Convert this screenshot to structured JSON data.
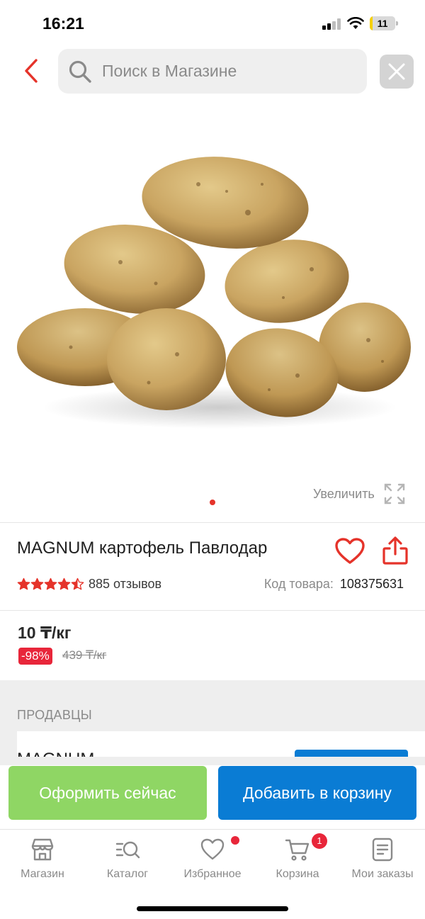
{
  "status_bar": {
    "time": "16:21",
    "battery": "11",
    "battery_level": 0.11
  },
  "search": {
    "placeholder": "Поиск в Магазине"
  },
  "product": {
    "zoom_label": "Увеличить",
    "title": "MAGNUM картофель Павлодар",
    "rating": 4.5,
    "reviews": "885 отзывов",
    "sku_label": "Код товара:",
    "sku_value": "108375631",
    "price": "10 ₸/кг",
    "discount": "-98%",
    "old_price": "439 ₸/кг"
  },
  "sellers": {
    "title": "ПРОДАВЦЫ",
    "first_seller": "MAGNUM"
  },
  "actions": {
    "checkout": "Оформить сейчас",
    "add_to_cart": "Добавить в корзину"
  },
  "tabbar": {
    "items": [
      {
        "label": "Магазин",
        "icon": "store-icon"
      },
      {
        "label": "Каталог",
        "icon": "catalog-search-icon"
      },
      {
        "label": "Избранное",
        "icon": "heart-icon"
      },
      {
        "label": "Корзина",
        "icon": "cart-icon"
      },
      {
        "label": "Мои заказы",
        "icon": "orders-icon"
      }
    ],
    "cart_count": "1"
  },
  "colors": {
    "accent_red": "#e5332a",
    "checkout_green": "#8fd664",
    "cart_blue": "#0a7cd4",
    "badge_red": "#e8263a"
  }
}
